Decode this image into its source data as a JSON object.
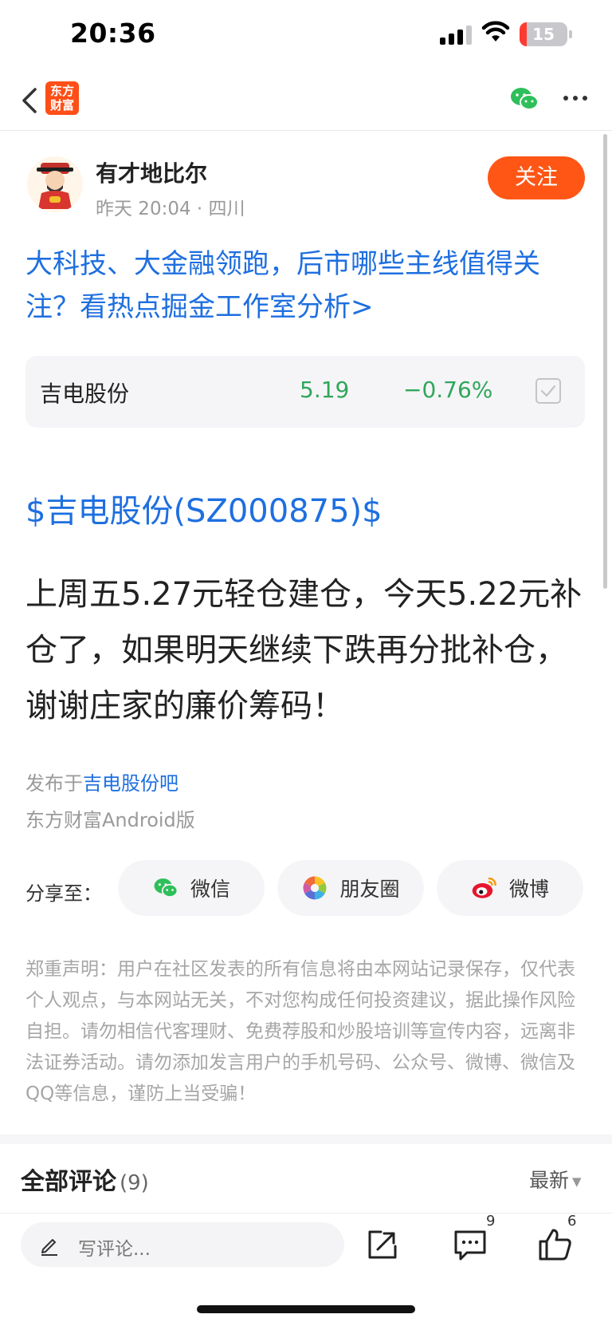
{
  "status_bar": {
    "time": "20:36",
    "battery_level": "15",
    "battery_fraction": 0.15
  },
  "nav": {
    "logo_text": "东方财富"
  },
  "author": {
    "name": "有才地比尔",
    "meta": "昨天 20:04 · 四川",
    "follow_label": "关注"
  },
  "headline_link": "大科技、大金融领跑，后市哪些主线值得关注？看热点掘金工作室分析>",
  "stock": {
    "name": "吉电股份",
    "price": "5.19",
    "change": "−0.76%"
  },
  "post": {
    "tag": "$吉电股份(SZ000875)$",
    "body": "上周五5.27元轻仓建仓，今天5.22元补仓了，如果明天继续下跌再分批补仓，谢谢庄家的廉价筹码！",
    "posted_in_prefix": "发布于",
    "posted_in_bar": "吉电股份吧",
    "platform": "东方财富Android版"
  },
  "share": {
    "label": "分享至：",
    "options": [
      {
        "label": "微信",
        "icon": "wechat-icon"
      },
      {
        "label": "朋友圈",
        "icon": "moments-icon"
      },
      {
        "label": "微博",
        "icon": "weibo-icon"
      }
    ]
  },
  "disclaimer": "郑重声明：用户在社区发表的所有信息将由本网站记录保存，仅代表个人观点，与本网站无关，不对您构成任何投资建议，据此操作风险自担。请勿相信代客理财、免费荐股和炒股培训等宣传内容，远离非法证券活动。请勿添加发言用户的手机号码、公众号、微博、微信及QQ等信息，谨防上当受骗！",
  "comments": {
    "title": "全部评论",
    "count": "(9)",
    "sort_label": "最新"
  },
  "toolbar": {
    "input_placeholder": "写评论...",
    "comment_badge": "9",
    "like_badge": "6"
  },
  "colors": {
    "accent": "#ff5615",
    "link": "#1e6fe0",
    "down": "#2fa75b"
  }
}
